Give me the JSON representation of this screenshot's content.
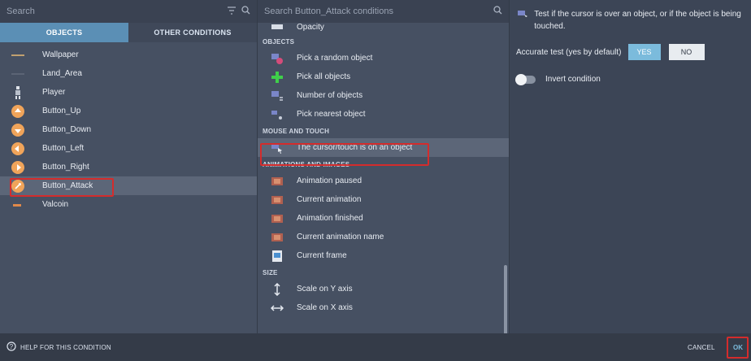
{
  "left": {
    "search_placeholder": "Search",
    "tabs": [
      {
        "label": "OBJECTS",
        "active": true
      },
      {
        "label": "OTHER CONDITIONS",
        "active": false
      }
    ],
    "objects": [
      {
        "label": "Wallpaper",
        "icon": "line-icon"
      },
      {
        "label": "Land_Area",
        "icon": "line-icon"
      },
      {
        "label": "Player",
        "icon": "player-sprite-icon"
      },
      {
        "label": "Button_Up",
        "icon": "arrow-up-circle-icon"
      },
      {
        "label": "Button_Down",
        "icon": "arrow-down-circle-icon"
      },
      {
        "label": "Button_Left",
        "icon": "arrow-left-circle-icon"
      },
      {
        "label": "Button_Right",
        "icon": "arrow-right-circle-icon"
      },
      {
        "label": "Button_Attack",
        "icon": "attack-circle-icon",
        "selected": true
      },
      {
        "label": "Valcoin",
        "icon": "coin-icon"
      }
    ]
  },
  "middle": {
    "search_placeholder": "Search Button_Attack conditions",
    "items": [
      {
        "type": "item",
        "label": "Opacity",
        "icon": "opacity-icon"
      },
      {
        "type": "group",
        "label": "OBJECTS"
      },
      {
        "type": "item",
        "label": "Pick a random object",
        "icon": "random-object-icon"
      },
      {
        "type": "item",
        "label": "Pick all objects",
        "icon": "plus-icon"
      },
      {
        "type": "item",
        "label": "Number of objects",
        "icon": "number-objects-icon"
      },
      {
        "type": "item",
        "label": "Pick nearest object",
        "icon": "nearest-object-icon"
      },
      {
        "type": "group",
        "label": "MOUSE AND TOUCH"
      },
      {
        "type": "item",
        "label": "The cursor/touch is on an object",
        "icon": "cursor-object-icon",
        "selected": true
      },
      {
        "type": "group",
        "label": "ANIMATIONS AND IMAGES"
      },
      {
        "type": "item",
        "label": "Animation paused",
        "icon": "film-icon"
      },
      {
        "type": "item",
        "label": "Current animation",
        "icon": "film-icon"
      },
      {
        "type": "item",
        "label": "Animation finished",
        "icon": "film-icon"
      },
      {
        "type": "item",
        "label": "Current animation name",
        "icon": "film-icon"
      },
      {
        "type": "item",
        "label": "Current frame",
        "icon": "frame-icon"
      },
      {
        "type": "group",
        "label": "SIZE"
      },
      {
        "type": "item",
        "label": "Scale on Y axis",
        "icon": "scale-y-icon"
      },
      {
        "type": "item",
        "label": "Scale on X axis",
        "icon": "scale-x-icon"
      }
    ]
  },
  "right": {
    "description": "Test if the cursor is over an object, or if the object is being touched.",
    "accurate_label": "Accurate test (yes by default)",
    "yes_label": "YES",
    "no_label": "NO",
    "invert_label": "Invert condition"
  },
  "footer": {
    "help_label": "HELP FOR THIS CONDITION",
    "cancel_label": "CANCEL",
    "ok_label": "OK"
  },
  "colors": {
    "accent": "#5b8fb5",
    "highlight_box": "#d42c2c",
    "yes_button": "#7bbbdc"
  }
}
